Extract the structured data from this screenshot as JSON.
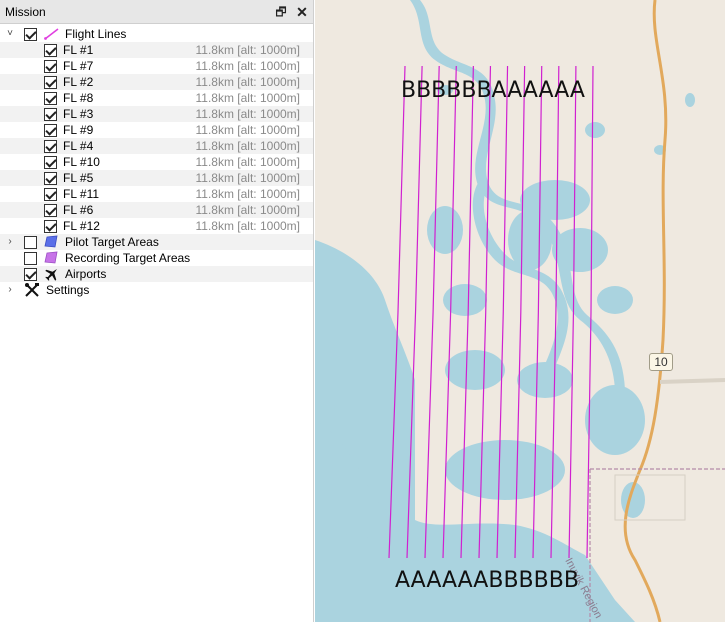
{
  "panel": {
    "title": "Mission",
    "restore_glyph": "🗗",
    "close_glyph": "✕"
  },
  "tree": {
    "flight_lines": {
      "label": "Flight Lines",
      "checked": true,
      "expanded": true,
      "icon": "line-icon",
      "color": "#e040e0"
    },
    "items": [
      {
        "label": "FL #1",
        "info": "11.8km [alt: 1000m]",
        "checked": true
      },
      {
        "label": "FL #7",
        "info": "11.8km [alt: 1000m]",
        "checked": true
      },
      {
        "label": "FL #2",
        "info": "11.8km [alt: 1000m]",
        "checked": true
      },
      {
        "label": "FL #8",
        "info": "11.8km [alt: 1000m]",
        "checked": true
      },
      {
        "label": "FL #3",
        "info": "11.8km [alt: 1000m]",
        "checked": true
      },
      {
        "label": "FL #9",
        "info": "11.8km [alt: 1000m]",
        "checked": true
      },
      {
        "label": "FL #4",
        "info": "11.8km [alt: 1000m]",
        "checked": true
      },
      {
        "label": "FL #10",
        "info": "11.8km [alt: 1000m]",
        "checked": true
      },
      {
        "label": "FL #5",
        "info": "11.8km [alt: 1000m]",
        "checked": true
      },
      {
        "label": "FL #11",
        "info": "11.8km [alt: 1000m]",
        "checked": true
      },
      {
        "label": "FL #6",
        "info": "11.8km [alt: 1000m]",
        "checked": true
      },
      {
        "label": "FL #12",
        "info": "11.8km [alt: 1000m]",
        "checked": true
      }
    ],
    "pilot_target_areas": {
      "label": "Pilot Target Areas",
      "checked": false,
      "icon": "polygon-icon",
      "color": "#5a6fe8"
    },
    "recording_target_areas": {
      "label": "Recording Target Areas",
      "checked": false,
      "icon": "polygon-icon",
      "color": "#c774e8"
    },
    "airports": {
      "label": "Airports",
      "checked": true,
      "icon": "airplane-icon"
    },
    "settings": {
      "label": "Settings",
      "icon": "tools-icon"
    }
  },
  "map": {
    "top_sequence": "BBBBBBAAAAAA",
    "bottom_sequence": "AAAAAABBBBBB",
    "route_number": "10",
    "region_label": "Inuvik Region",
    "line_color": "#d020d0",
    "water_color": "#aad3df",
    "land_color": "#efe9e0",
    "road_color": "#e2a95c"
  }
}
